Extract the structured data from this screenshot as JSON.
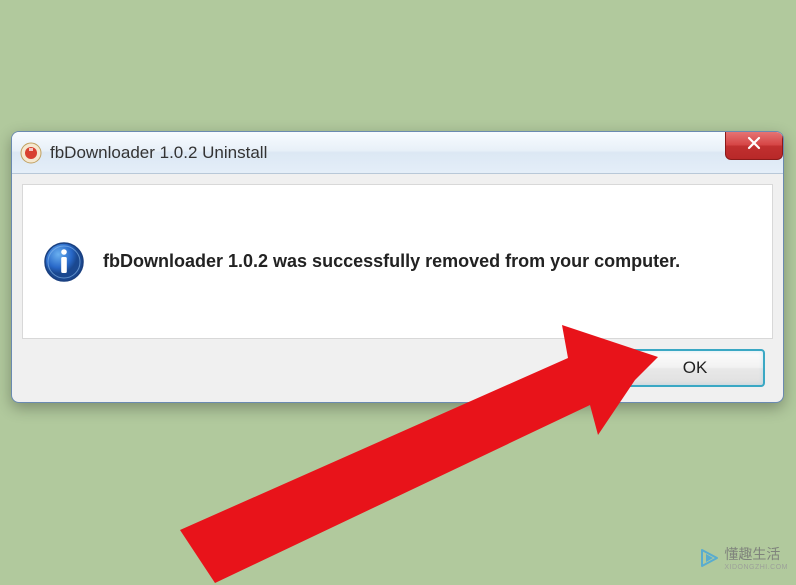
{
  "dialog": {
    "title": "fbDownloader 1.0.2 Uninstall",
    "message": "fbDownloader 1.0.2 was successfully removed from your computer.",
    "ok_label": "OK"
  },
  "watermark": {
    "text": "懂趣生活",
    "sub": "XIDONGZHI.COM"
  }
}
